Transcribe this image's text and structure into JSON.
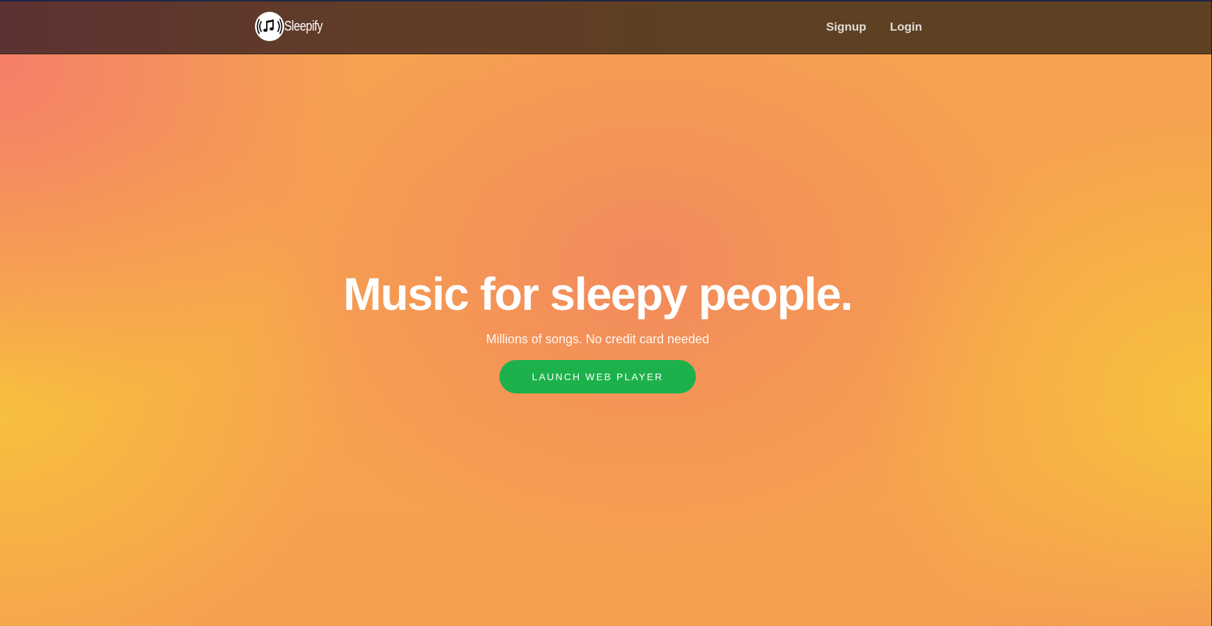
{
  "navbar": {
    "brand_name": "Sleepify",
    "logo_icon": "music-note-broadcast-icon",
    "links": [
      "Signup",
      "Login"
    ]
  },
  "hero": {
    "headline": "Music for sleepy people.",
    "subtitle": "Millions of songs. No credit card needed",
    "cta_label": "LAUNCH WEB PLAYER"
  },
  "colors": {
    "navbar": "#5e3f25",
    "hero_orange": "#f5a350",
    "hero_yellow": "#f8c33c",
    "hero_coral": "#f2875f",
    "cta_green": "#1db14b",
    "text_white": "#ffffff"
  }
}
